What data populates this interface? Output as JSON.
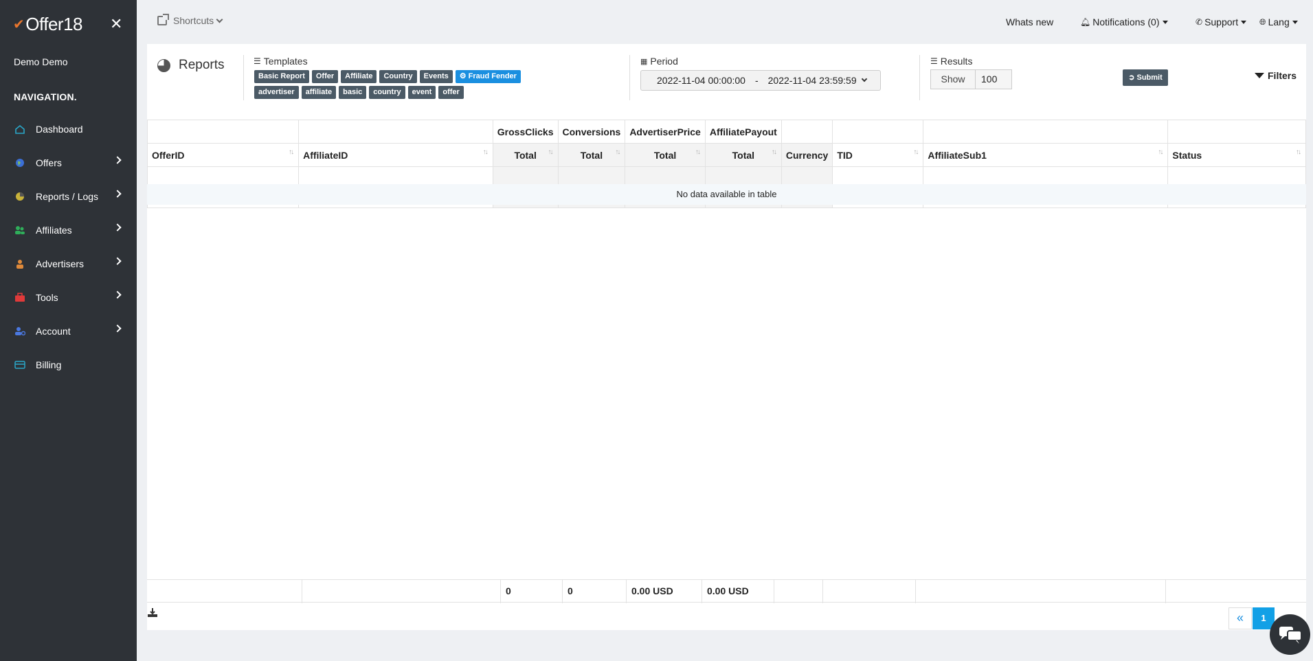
{
  "brand": {
    "name": "Offer18"
  },
  "user": {
    "name": "Demo Demo"
  },
  "nav": {
    "heading": "NAVIGATION.",
    "items": [
      {
        "label": "Dashboard",
        "icon": "home-icon",
        "color": "#2aa7c9"
      },
      {
        "label": "Offers",
        "icon": "globe-icon",
        "color": "#3b6fd6"
      },
      {
        "label": "Reports / Logs",
        "icon": "pie-chart-icon",
        "color": "#c8b23a"
      },
      {
        "label": "Affiliates",
        "icon": "users-icon",
        "color": "#2fae5a"
      },
      {
        "label": "Advertisers",
        "icon": "user-tie-icon",
        "color": "#e08a3a"
      },
      {
        "label": "Tools",
        "icon": "toolbox-icon",
        "color": "#e03a3a"
      },
      {
        "label": "Account",
        "icon": "user-cog-icon",
        "color": "#4a78e0"
      },
      {
        "label": "Billing",
        "icon": "credit-card-icon",
        "color": "#2aa7c9"
      }
    ]
  },
  "topbar": {
    "shortcuts": "Shortcuts",
    "whats_new": "Whats new",
    "notifications": "Notifications (0)",
    "support": "Support",
    "lang": "Lang"
  },
  "reports": {
    "title": "Reports",
    "templates_label": "Templates",
    "templates_row1": [
      "Basic Report",
      "Offer",
      "Affiliate",
      "Country",
      "Events",
      "Fraud Fender"
    ],
    "templates_row2": [
      "advertiser",
      "affiliate",
      "basic",
      "country",
      "event",
      "offer"
    ],
    "period_label": "Period",
    "period_start": "2022-11-04 00:00:00",
    "period_sep": "-",
    "period_end": "2022-11-04 23:59:59",
    "results_label": "Results",
    "show_label": "Show",
    "show_value": "100",
    "submit": "Submit",
    "filters": "Filters"
  },
  "table": {
    "group_headers": [
      "GrossClicks",
      "Conversions",
      "AdvertiserPrice",
      "AffiliatePayout"
    ],
    "columns": [
      "OfferID",
      "AffiliateID",
      "Total",
      "Total",
      "Total",
      "Total",
      "Currency",
      "TID",
      "AffiliateSub1",
      "Status"
    ],
    "empty_message": "No data available in table",
    "footer": [
      "0",
      "0",
      "0.00 USD",
      "0.00 USD"
    ]
  },
  "pager": {
    "prev": "«",
    "current": "1"
  }
}
